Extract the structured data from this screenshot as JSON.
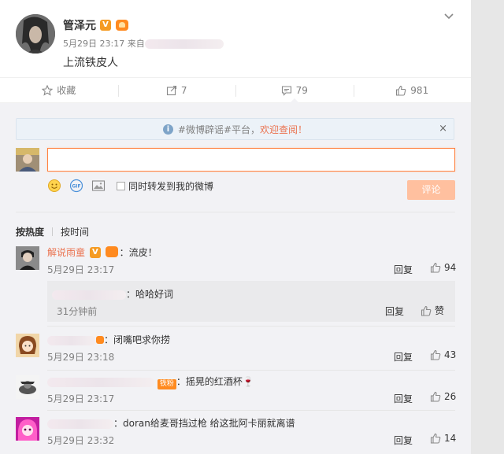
{
  "post": {
    "author": "管泽元",
    "date": "5月29日 23:17",
    "source_prefix": "来自",
    "text": "上流铁皮人"
  },
  "actions": {
    "favorite": "收藏",
    "repost_count": "7",
    "comment_count": "79",
    "like_count": "981"
  },
  "notice": {
    "prefix": "#微博辟谣#平台，",
    "link": "欢迎查阅！",
    "close": "×"
  },
  "composer": {
    "gif_label": "GIF",
    "forward_label": "同时转发到我的微博",
    "submit": "评论"
  },
  "sort": {
    "hot": "按热度",
    "time": "按时间"
  },
  "comments": [
    {
      "user": "解说雨童",
      "text": "：流皮！",
      "time": "5月29日 23:17",
      "reply": "回复",
      "likes": "94"
    },
    {
      "user": "",
      "text": "：闭嘴吧求你捞",
      "time": "5月29日 23:18",
      "reply": "回复",
      "likes": "43"
    },
    {
      "user": "",
      "fan_badge": "铁粉",
      "text": "：摇晃的红酒杯🍷",
      "time": "5月29日 23:17",
      "reply": "回复",
      "likes": "26"
    },
    {
      "user": "",
      "text": "：doran给麦哥挡过枪 给这批阿卡丽就离谱",
      "time": "5月29日 23:32",
      "reply": "回复",
      "likes": "14"
    }
  ],
  "sub_reply": {
    "text": "：哈哈好词",
    "time": "31分钟前",
    "reply": "回复",
    "like_label": "赞"
  },
  "colors": {
    "accent": "#eb7350",
    "vip_orange": "#f59b23",
    "input_border": "#ff8140",
    "submit_disabled": "#ffc09f",
    "notice_bg": "#ecf2f8"
  }
}
